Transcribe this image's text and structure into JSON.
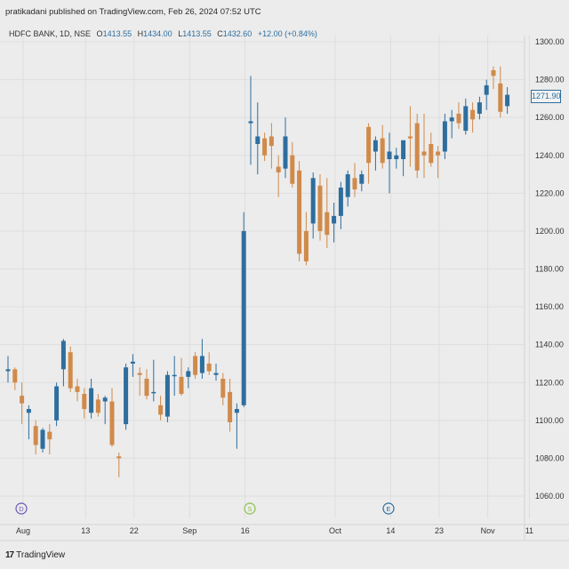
{
  "header": {
    "publisher_note": "pratikadani published on TradingView.com, Feb 26, 2024 07:52 UTC"
  },
  "legend": {
    "symbol": "HDFC BANK, 1D, NSE",
    "open_label": "O",
    "open": "1413.55",
    "high_label": "H",
    "high": "1434.00",
    "low_label": "L",
    "low": "1413.55",
    "close_label": "C",
    "close": "1432.60",
    "change": "+12.00 (+0.84%)"
  },
  "price_tag": "1271.90",
  "footer": {
    "brand": "TradingView",
    "logo": "17"
  },
  "event_markers": [
    {
      "letter": "D",
      "x": "Jul 31",
      "color": "#6b55b5",
      "icon": "dividend-marker"
    },
    {
      "letter": "S",
      "x": "Aug 27",
      "color": "#8cbf4a",
      "icon": "split-marker"
    },
    {
      "letter": "E",
      "x": "Oct 21",
      "color": "#2e6e9e",
      "icon": "earnings-marker"
    }
  ],
  "colors": {
    "up": "#2e6e9e",
    "down": "#d08a4a",
    "background": "#ececec",
    "grid": "#dedede",
    "axis_text": "#333333"
  },
  "chart_data": {
    "type": "candlestick",
    "title": "",
    "ylim": [
      1050,
      1305
    ],
    "y_ticks": [
      1060,
      1080,
      1100,
      1120,
      1140,
      1160,
      1180,
      1200,
      1220,
      1240,
      1260,
      1280,
      1300
    ],
    "x_ticks": [
      {
        "label": "Aug",
        "index": 0
      },
      {
        "label": "13",
        "index": 9
      },
      {
        "label": "22",
        "index": 16
      },
      {
        "label": "Sep",
        "index": 24
      },
      {
        "label": "16",
        "index": 32
      },
      {
        "label": "Oct",
        "index": 45
      },
      {
        "label": "14",
        "index": 53
      },
      {
        "label": "23",
        "index": 60
      },
      {
        "label": "Nov",
        "index": 67
      },
      {
        "label": "11",
        "index": 73
      }
    ],
    "grid": true,
    "candles": [
      {
        "o": 1126,
        "h": 1134,
        "l": 1120,
        "c": 1127
      },
      {
        "o": 1127,
        "h": 1128,
        "l": 1116,
        "c": 1120
      },
      {
        "o": 1113,
        "h": 1120,
        "l": 1098,
        "c": 1109
      },
      {
        "o": 1104,
        "h": 1108,
        "l": 1090,
        "c": 1106
      },
      {
        "o": 1097,
        "h": 1100,
        "l": 1082,
        "c": 1087
      },
      {
        "o": 1085,
        "h": 1096,
        "l": 1083,
        "c": 1095
      },
      {
        "o": 1094,
        "h": 1098,
        "l": 1082,
        "c": 1090
      },
      {
        "o": 1100,
        "h": 1120,
        "l": 1097,
        "c": 1118
      },
      {
        "o": 1127,
        "h": 1143,
        "l": 1118,
        "c": 1142
      },
      {
        "o": 1136,
        "h": 1139,
        "l": 1115,
        "c": 1117
      },
      {
        "o": 1118,
        "h": 1122,
        "l": 1110,
        "c": 1115
      },
      {
        "o": 1114,
        "h": 1117,
        "l": 1101,
        "c": 1106
      },
      {
        "o": 1104,
        "h": 1122,
        "l": 1101,
        "c": 1117
      },
      {
        "o": 1111,
        "h": 1114,
        "l": 1102,
        "c": 1104
      },
      {
        "o": 1110,
        "h": 1113,
        "l": 1098,
        "c": 1112
      },
      {
        "o": 1110,
        "h": 1117,
        "l": 1086,
        "c": 1087
      },
      {
        "o": 1081,
        "h": 1083,
        "l": 1070,
        "c": 1080
      },
      {
        "o": 1098,
        "h": 1130,
        "l": 1095,
        "c": 1128
      },
      {
        "o": 1130,
        "h": 1135,
        "l": 1123,
        "c": 1131
      },
      {
        "o": 1125,
        "h": 1128,
        "l": 1113,
        "c": 1124
      },
      {
        "o": 1122,
        "h": 1127,
        "l": 1111,
        "c": 1113
      },
      {
        "o": 1115,
        "h": 1132,
        "l": 1110,
        "c": 1115
      },
      {
        "o": 1108,
        "h": 1113,
        "l": 1100,
        "c": 1103
      },
      {
        "o": 1102,
        "h": 1126,
        "l": 1099,
        "c": 1124
      },
      {
        "o": 1124,
        "h": 1134,
        "l": 1113,
        "c": 1124
      },
      {
        "o": 1123,
        "h": 1133,
        "l": 1113,
        "c": 1114
      },
      {
        "o": 1123,
        "h": 1128,
        "l": 1117,
        "c": 1126
      },
      {
        "o": 1134,
        "h": 1136,
        "l": 1122,
        "c": 1124
      },
      {
        "o": 1125,
        "h": 1143,
        "l": 1122,
        "c": 1134
      },
      {
        "o": 1130,
        "h": 1136,
        "l": 1124,
        "c": 1126
      },
      {
        "o": 1124,
        "h": 1130,
        "l": 1121,
        "c": 1125
      },
      {
        "o": 1122,
        "h": 1125,
        "l": 1108,
        "c": 1112
      },
      {
        "o": 1115,
        "h": 1122,
        "l": 1094,
        "c": 1099
      },
      {
        "o": 1104,
        "h": 1109,
        "l": 1085,
        "c": 1106
      },
      {
        "o": 1108,
        "h": 1210,
        "l": 1107,
        "c": 1200
      },
      {
        "o": 1257,
        "h": 1282,
        "l": 1235,
        "c": 1258
      },
      {
        "o": 1246,
        "h": 1268,
        "l": 1230,
        "c": 1250
      },
      {
        "o": 1249,
        "h": 1252,
        "l": 1237,
        "c": 1240
      },
      {
        "o": 1250,
        "h": 1257,
        "l": 1233,
        "c": 1245
      },
      {
        "o": 1234,
        "h": 1240,
        "l": 1218,
        "c": 1231
      },
      {
        "o": 1233,
        "h": 1260,
        "l": 1228,
        "c": 1250
      },
      {
        "o": 1240,
        "h": 1247,
        "l": 1223,
        "c": 1225
      },
      {
        "o": 1232,
        "h": 1237,
        "l": 1184,
        "c": 1188
      },
      {
        "o": 1200,
        "h": 1210,
        "l": 1182,
        "c": 1184
      },
      {
        "o": 1204,
        "h": 1231,
        "l": 1196,
        "c": 1228
      },
      {
        "o": 1224,
        "h": 1230,
        "l": 1195,
        "c": 1200
      },
      {
        "o": 1210,
        "h": 1228,
        "l": 1191,
        "c": 1198
      },
      {
        "o": 1204,
        "h": 1215,
        "l": 1194,
        "c": 1208
      },
      {
        "o": 1208,
        "h": 1226,
        "l": 1201,
        "c": 1223
      },
      {
        "o": 1218,
        "h": 1232,
        "l": 1213,
        "c": 1230
      },
      {
        "o": 1228,
        "h": 1236,
        "l": 1218,
        "c": 1222
      },
      {
        "o": 1225,
        "h": 1232,
        "l": 1221,
        "c": 1230
      },
      {
        "o": 1255,
        "h": 1257,
        "l": 1225,
        "c": 1236
      },
      {
        "o": 1242,
        "h": 1250,
        "l": 1232,
        "c": 1248
      },
      {
        "o": 1249,
        "h": 1256,
        "l": 1233,
        "c": 1236
      },
      {
        "o": 1238,
        "h": 1252,
        "l": 1220,
        "c": 1242
      },
      {
        "o": 1238,
        "h": 1244,
        "l": 1233,
        "c": 1240
      },
      {
        "o": 1238,
        "h": 1247,
        "l": 1229,
        "c": 1248
      },
      {
        "o": 1250,
        "h": 1266,
        "l": 1234,
        "c": 1249
      },
      {
        "o": 1257,
        "h": 1262,
        "l": 1228,
        "c": 1232
      },
      {
        "o": 1242,
        "h": 1262,
        "l": 1228,
        "c": 1240
      },
      {
        "o": 1246,
        "h": 1252,
        "l": 1234,
        "c": 1236
      },
      {
        "o": 1242,
        "h": 1245,
        "l": 1228,
        "c": 1240
      },
      {
        "o": 1242,
        "h": 1262,
        "l": 1238,
        "c": 1258
      },
      {
        "o": 1258,
        "h": 1264,
        "l": 1249,
        "c": 1260
      },
      {
        "o": 1262,
        "h": 1268,
        "l": 1254,
        "c": 1257
      },
      {
        "o": 1253,
        "h": 1270,
        "l": 1251,
        "c": 1266
      },
      {
        "o": 1264,
        "h": 1268,
        "l": 1252,
        "c": 1259
      },
      {
        "o": 1262,
        "h": 1271,
        "l": 1259,
        "c": 1268
      },
      {
        "o": 1272,
        "h": 1280,
        "l": 1264,
        "c": 1277
      },
      {
        "o": 1285,
        "h": 1287,
        "l": 1275,
        "c": 1282
      },
      {
        "o": 1278,
        "h": 1287,
        "l": 1260,
        "c": 1263
      },
      {
        "o": 1266,
        "h": 1276,
        "l": 1262,
        "c": 1272
      }
    ]
  }
}
